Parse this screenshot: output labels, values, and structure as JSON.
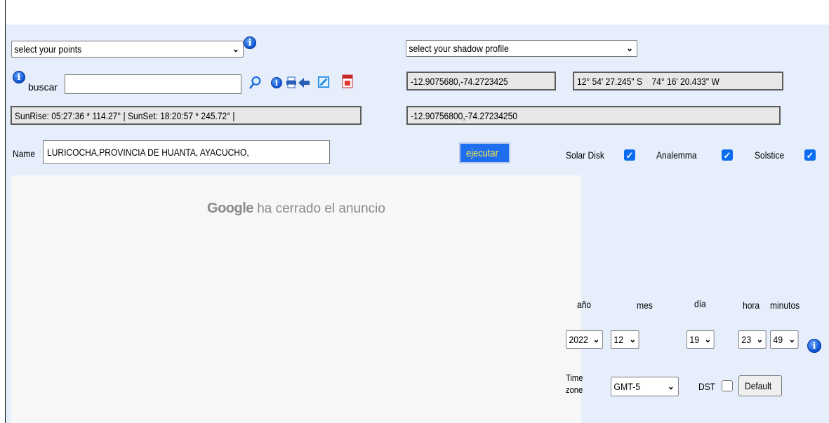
{
  "points_select": {
    "value": "select your points"
  },
  "shadow_select": {
    "value": "select your shadow profile"
  },
  "search": {
    "label": "buscar",
    "value": ""
  },
  "coords": {
    "decimal": "-12.9075680,-74.2723425",
    "dms_lat": "12° 54' 27.245\" S",
    "dms_lon": "74° 16' 20.433\" W",
    "precise": "-12.90756800,-74.27234250"
  },
  "sun": {
    "info": "SunRise: 05:27:36 * 114.27° | SunSet: 18:20:57 * 245.72° |"
  },
  "name": {
    "label": "Name",
    "value": "LURICOCHA,PROVINCIA DE HUANTA, AYACUCHO,"
  },
  "execute_label": "ejecutar",
  "options": [
    {
      "label": "Solar Disk",
      "checked": true
    },
    {
      "label": "Analemma",
      "checked": true
    },
    {
      "label": "Solstice",
      "checked": true
    }
  ],
  "ad": {
    "brand": "Google",
    "text": "ha cerrado el anuncio"
  },
  "date": {
    "headers": {
      "year": "año",
      "month": "mes",
      "day": "día",
      "hour": "hora",
      "minute": "minutos"
    },
    "year": "2022",
    "month": "12",
    "day": "19",
    "hour": "23",
    "minute": "49"
  },
  "timezone": {
    "label_line1": "Time",
    "label_line2": "zone",
    "value": "GMT-5"
  },
  "dst": {
    "label": "DST",
    "checked": false
  },
  "default_label": "Default",
  "chevron": "⌄"
}
